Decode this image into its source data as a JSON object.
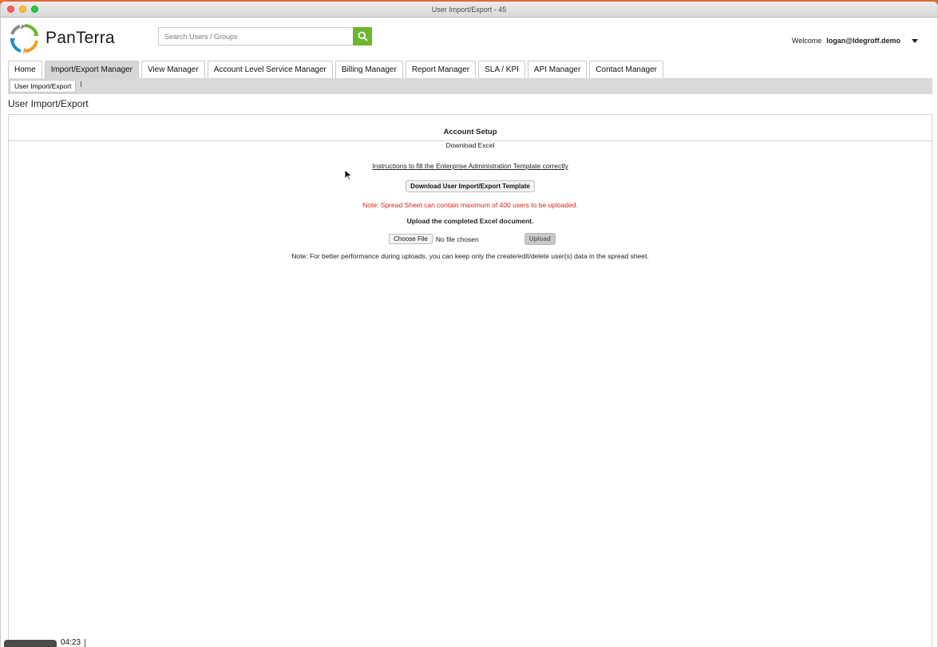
{
  "window": {
    "title": "User Import/Export - 45"
  },
  "header": {
    "logo_text": "PanTerra",
    "search_placeholder": "Search Users / Groups",
    "welcome_prefix": "Welcome",
    "username": "logan@ldegroff.demo"
  },
  "tabs": [
    {
      "label": "Home",
      "active": false
    },
    {
      "label": "Import/Export Manager",
      "active": true
    },
    {
      "label": "View Manager",
      "active": false
    },
    {
      "label": "Account Level Service Manager",
      "active": false
    },
    {
      "label": "Billing Manager",
      "active": false
    },
    {
      "label": "Report Manager",
      "active": false
    },
    {
      "label": "SLA / KPI",
      "active": false
    },
    {
      "label": "API Manager",
      "active": false
    },
    {
      "label": "Contact Manager",
      "active": false
    }
  ],
  "subtabs": {
    "current": "User Import/Export"
  },
  "page": {
    "title": "User Import/Export"
  },
  "panel": {
    "heading": "Account Setup",
    "download_excel": "Download Excel",
    "instructions_link": "Instructions to fill the Enterprise Administration Template correctly",
    "template_button": "Download User Import/Export Template",
    "limit_note": "Note: Spread Sheet can contain maximum of 400 users to be uploaded.",
    "upload_heading": "Upload the completed Excel document.",
    "choose_file_label": "Choose File",
    "no_file_text": "No file chosen",
    "upload_button": "Upload",
    "performance_note": "Note: For better performance during uploads, you can keep only the create/edit/delete user(s) data in the spread sheet."
  },
  "video": {
    "timestamp": "04:23"
  },
  "colors": {
    "brand_green": "#6eb52e",
    "note_red": "#d9231d",
    "active_tab": "#d6d6d6"
  },
  "icons": {
    "logo": "panterra-logo-icon",
    "search": "search-icon",
    "dropdown": "chevron-down-icon",
    "cursor": "mouse-pointer-icon"
  }
}
